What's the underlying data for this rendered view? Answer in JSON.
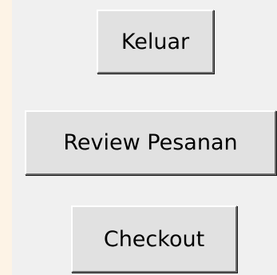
{
  "window": {
    "background_color": "#fdf3e6",
    "panel_color": "#f0f0f0"
  },
  "buttons": {
    "keluar_label": "Keluar",
    "review_label": "Review Pesanan",
    "checkout_label": "Checkout"
  }
}
